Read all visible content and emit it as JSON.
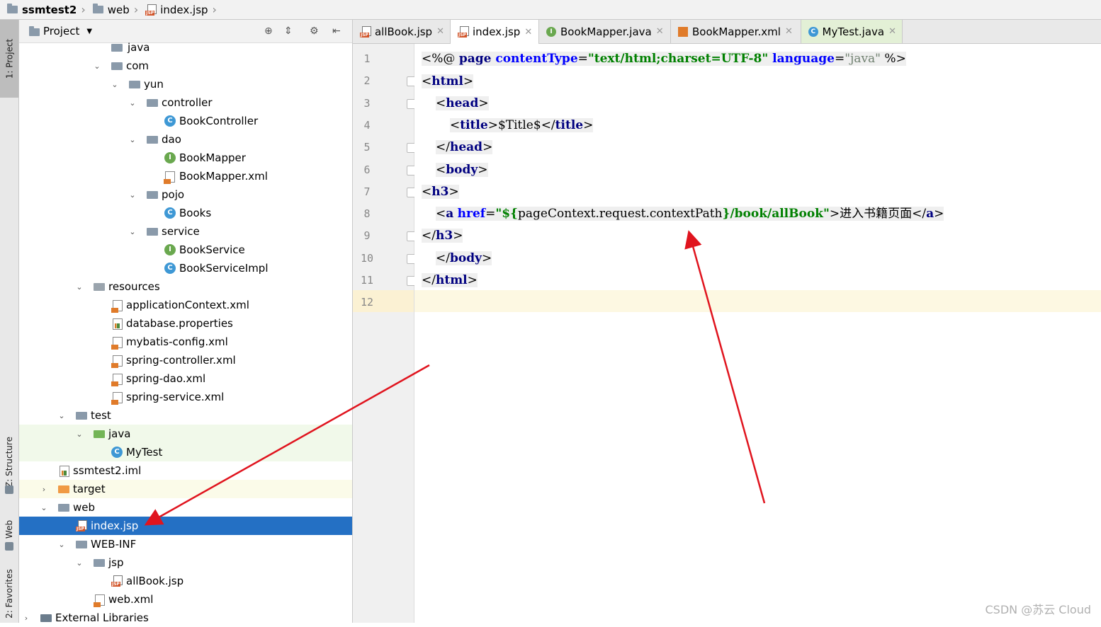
{
  "breadcrumb": {
    "project": "ssmtest2",
    "folder": "web",
    "file": "index.jsp"
  },
  "side_strip": {
    "project_tab": "1: Project",
    "structure_tab": "Z: Structure",
    "web_tab": "Web",
    "favorites_tab": "2: Favorites"
  },
  "project_panel": {
    "title": "Project",
    "rows": [
      {
        "label": "java"
      },
      {
        "label": "com"
      },
      {
        "label": "yun"
      },
      {
        "label": "controller"
      },
      {
        "label": "BookController"
      },
      {
        "label": "dao"
      },
      {
        "label": "BookMapper"
      },
      {
        "label": "BookMapper.xml"
      },
      {
        "label": "pojo"
      },
      {
        "label": "Books"
      },
      {
        "label": "service"
      },
      {
        "label": "BookService"
      },
      {
        "label": "BookServiceImpl"
      },
      {
        "label": "resources"
      },
      {
        "label": "applicationContext.xml"
      },
      {
        "label": "database.properties"
      },
      {
        "label": "mybatis-config.xml"
      },
      {
        "label": "spring-controller.xml"
      },
      {
        "label": "spring-dao.xml"
      },
      {
        "label": "spring-service.xml"
      },
      {
        "label": "test"
      },
      {
        "label": "java"
      },
      {
        "label": "MyTest"
      },
      {
        "label": "ssmtest2.iml"
      },
      {
        "label": "target"
      },
      {
        "label": "web"
      },
      {
        "label": "index.jsp"
      },
      {
        "label": "WEB-INF"
      },
      {
        "label": "jsp"
      },
      {
        "label": "allBook.jsp"
      },
      {
        "label": "web.xml"
      },
      {
        "label": "External Libraries"
      }
    ]
  },
  "editor": {
    "tabs": [
      {
        "label": "allBook.jsp"
      },
      {
        "label": "index.jsp"
      },
      {
        "label": "BookMapper.java"
      },
      {
        "label": "BookMapper.xml"
      },
      {
        "label": "MyTest.java"
      }
    ],
    "line_numbers": [
      "1",
      "2",
      "3",
      "4",
      "5",
      "6",
      "7",
      "8",
      "9",
      "10",
      "11",
      "12"
    ],
    "code": {
      "l1_open": "<%@ ",
      "l1_page": "page ",
      "l1_ct": "contentType",
      "l1_eq1": "=",
      "l1_ctval": "\"text/html;charset=UTF-8\"",
      "l1_lang": " language",
      "l1_eq2": "=",
      "l1_langval": "\"java\"",
      "l1_close": " %>",
      "l2_html": "html",
      "l3_head": "head",
      "l4_title": "title",
      "l4_text": "$Title$",
      "l5_head": "head",
      "l6_body": "body",
      "l7_h3": "h3",
      "l8_a": "a",
      "l8_href": "href",
      "l8_eq": "=",
      "l8_q1": "\"${",
      "l8_el": "pageContext.request.contextPath",
      "l8_q2": "}/book/allBook\"",
      "l8_text": "进入书籍页面",
      "l8_aclose": "a",
      "l9_h3": "h3",
      "l10_body": "body",
      "l11_html": "html"
    }
  },
  "watermark": "CSDN @苏云 Cloud",
  "colors": {
    "selection": "#2470c4",
    "annotation_arrow": "#e0141e",
    "tag": "#000080",
    "attribute": "#0000ff",
    "string": "#008000"
  }
}
